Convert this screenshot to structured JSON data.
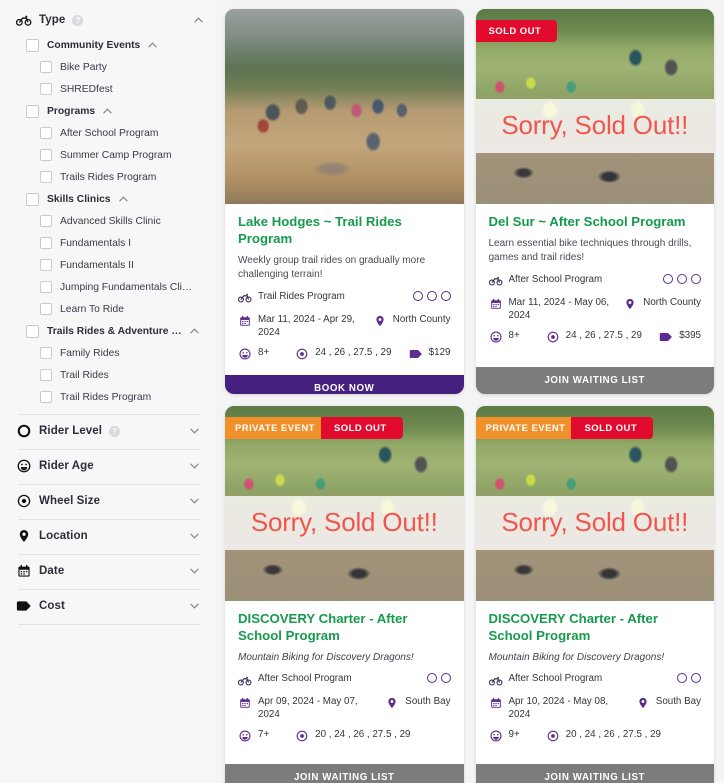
{
  "sidebar": {
    "sections": [
      {
        "id": "type",
        "label": "Type",
        "icon": "bike-icon",
        "has_help": true,
        "expanded": true,
        "groups": [
          {
            "label": "Community Events",
            "expanded": true,
            "items": [
              {
                "label": "Bike Party"
              },
              {
                "label": "SHREDfest"
              }
            ]
          },
          {
            "label": "Programs",
            "expanded": true,
            "items": [
              {
                "label": "After School Program"
              },
              {
                "label": "Summer Camp Program"
              },
              {
                "label": "Trails Rides Program"
              }
            ]
          },
          {
            "label": "Skills Clinics",
            "expanded": true,
            "items": [
              {
                "label": "Advanced Skills Clinic"
              },
              {
                "label": "Fundamentals I"
              },
              {
                "label": "Fundamentals II"
              },
              {
                "label": "Jumping Fundamentals Cli…"
              },
              {
                "label": "Learn To Ride"
              }
            ]
          },
          {
            "label": "Trails Rides & Adventure …",
            "expanded": true,
            "items": [
              {
                "label": "Family Rides"
              },
              {
                "label": "Trail Rides"
              },
              {
                "label": "Trail Rides Program"
              }
            ]
          }
        ]
      }
    ],
    "collapsed_sections": [
      {
        "id": "rider-level",
        "label": "Rider Level",
        "icon": "circle-outline-icon",
        "has_help": true
      },
      {
        "id": "rider-age",
        "label": "Rider Age",
        "icon": "smiley-icon",
        "has_help": false
      },
      {
        "id": "wheel-size",
        "label": "Wheel Size",
        "icon": "target-icon",
        "has_help": false
      },
      {
        "id": "location",
        "label": "Location",
        "icon": "map-pin-icon",
        "has_help": false
      },
      {
        "id": "date",
        "label": "Date",
        "icon": "calendar-icon",
        "has_help": false
      },
      {
        "id": "cost",
        "label": "Cost",
        "icon": "tag-icon",
        "has_help": false
      }
    ]
  },
  "cards": [
    {
      "title": "Lake Hodges ~ Trail Rides Program",
      "description": "Weekly group trail rides on gradually more challenging terrain!",
      "description_italic": false,
      "program_type": "Trail Rides Program",
      "rider_levels": 3,
      "date_range": "Mar 11, 2024 - Apr 29, 2024",
      "location": "North County",
      "age": "8+",
      "wheel_sizes": "24 , 26 , 27.5 , 29",
      "price": "$129",
      "cta": "BOOK NOW",
      "cta_style": "book",
      "badges": [],
      "sold_out_overlay": null,
      "photo": "trail"
    },
    {
      "title": "Del Sur ~ After School Program",
      "description": "Learn essential bike techniques through drills, games and trail rides!",
      "description_italic": false,
      "program_type": "After School Program",
      "rider_levels": 3,
      "date_range": "Mar 11, 2024 - May 06, 2024",
      "location": "North County",
      "age": "8+",
      "wheel_sizes": "24 , 26 , 27.5 , 29",
      "price": "$395",
      "cta": "JOIN WAITING LIST",
      "cta_style": "wait",
      "badges": [
        {
          "label": "SOLD OUT",
          "kind": "sold"
        }
      ],
      "sold_out_overlay": "Sorry, Sold Out!!",
      "photo": "field"
    },
    {
      "title": "DISCOVERY Charter - After School Program",
      "description": "Mountain Biking for Discovery Dragons!",
      "description_italic": true,
      "program_type": "After School Program",
      "rider_levels": 2,
      "date_range": "Apr 09, 2024 - May 07, 2024",
      "location": "South Bay",
      "age": "7+",
      "wheel_sizes": "20 , 24 , 26 , 27.5 , 29",
      "price": "",
      "cta": "JOIN WAITING LIST",
      "cta_style": "wait",
      "badges": [
        {
          "label": "PRIVATE EVENT",
          "kind": "private"
        },
        {
          "label": "SOLD OUT",
          "kind": "sold"
        }
      ],
      "sold_out_overlay": "Sorry, Sold Out!!",
      "photo": "field"
    },
    {
      "title": "DISCOVERY Charter - After School Program",
      "description": "Mountain Biking for Discovery Dragons!",
      "description_italic": true,
      "program_type": "After School Program",
      "rider_levels": 2,
      "date_range": "Apr 10, 2024 - May 08, 2024",
      "location": "South Bay",
      "age": "9+",
      "wheel_sizes": "20 , 24 , 26 , 27.5 , 29",
      "price": "",
      "cta": "JOIN WAITING LIST",
      "cta_style": "wait",
      "badges": [
        {
          "label": "PRIVATE EVENT",
          "kind": "private"
        },
        {
          "label": "SOLD OUT",
          "kind": "sold"
        }
      ],
      "sold_out_overlay": "Sorry, Sold Out!!",
      "photo": "field"
    }
  ],
  "colors": {
    "brand_purple": "#46207e",
    "title_green": "#169a4c",
    "sold_red": "#e30b2d",
    "private_orange": "#f0902a",
    "overlay_red": "#f0564e",
    "waitlist_gray": "#7c7c7c"
  },
  "help_glyph": "?"
}
